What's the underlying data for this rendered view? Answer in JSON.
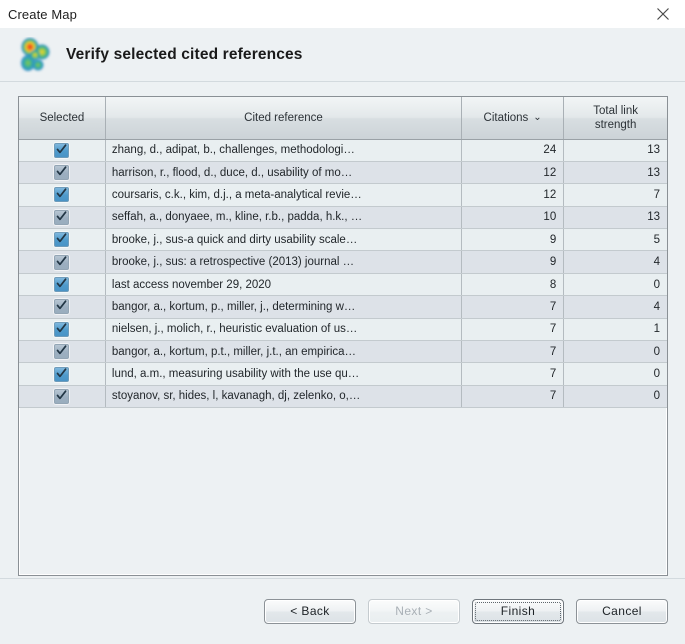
{
  "window": {
    "title": "Create Map",
    "close_icon": "close-icon"
  },
  "header": {
    "title": "Verify selected cited references",
    "logo_icon": "vosviewer-density-logo-icon"
  },
  "table": {
    "columns": [
      {
        "key": "selected",
        "label": "Selected",
        "sorted": false
      },
      {
        "key": "reference",
        "label": "Cited reference",
        "sorted": false
      },
      {
        "key": "citations",
        "label": "Citations",
        "sorted": true,
        "sort_caret": "⌄",
        "sort_direction": "desc"
      },
      {
        "key": "total_link_strength",
        "label": "Total link\nstrength",
        "label_line1": "Total link",
        "label_line2": "strength",
        "sorted": false
      }
    ],
    "rows": [
      {
        "selected": true,
        "reference": "zhang, d., adipat, b., challenges, methodologi…",
        "citations": "24",
        "total_link_strength": "13"
      },
      {
        "selected": true,
        "reference": "harrison, r., flood, d., duce, d., usability of mo…",
        "citations": "12",
        "total_link_strength": "13"
      },
      {
        "selected": true,
        "reference": "coursaris, c.k., kim, d.j., a meta-analytical revie…",
        "citations": "12",
        "total_link_strength": "7"
      },
      {
        "selected": true,
        "reference": "seffah, a., donyaee, m., kline, r.b., padda, h.k., …",
        "citations": "10",
        "total_link_strength": "13"
      },
      {
        "selected": true,
        "reference": "brooke, j., sus-a quick and dirty usability scale…",
        "citations": "9",
        "total_link_strength": "5"
      },
      {
        "selected": true,
        "reference": "brooke, j., sus: a retrospective (2013) journal …",
        "citations": "9",
        "total_link_strength": "4"
      },
      {
        "selected": true,
        "reference": "last access november 29, 2020",
        "citations": "8",
        "total_link_strength": "0"
      },
      {
        "selected": true,
        "reference": "bangor, a., kortum, p., miller, j., determining w…",
        "citations": "7",
        "total_link_strength": "4"
      },
      {
        "selected": true,
        "reference": "nielsen, j., molich, r., heuristic evaluation of us…",
        "citations": "7",
        "total_link_strength": "1"
      },
      {
        "selected": true,
        "reference": "bangor, a., kortum, p.t., miller, j.t., an empirica…",
        "citations": "7",
        "total_link_strength": "0"
      },
      {
        "selected": true,
        "reference": "lund, a.m., measuring usability with the use qu…",
        "citations": "7",
        "total_link_strength": "0"
      },
      {
        "selected": true,
        "reference": "stoyanov, sr, hides, l, kavanagh, dj, zelenko, o,…",
        "citations": "7",
        "total_link_strength": "0"
      }
    ]
  },
  "footer": {
    "buttons": [
      {
        "key": "back",
        "label": "< Back",
        "state": "enabled"
      },
      {
        "key": "next",
        "label": "Next >",
        "state": "disabled"
      },
      {
        "key": "finish",
        "label": "Finish",
        "state": "focused"
      },
      {
        "key": "cancel",
        "label": "Cancel",
        "state": "enabled"
      }
    ]
  },
  "colors": {
    "checkbox_blue": "#4e9acb",
    "window_background": "#edf1f3",
    "row_odd": "#e9eff1",
    "row_even": "#dde2e8",
    "table_border": "#8a9095"
  }
}
